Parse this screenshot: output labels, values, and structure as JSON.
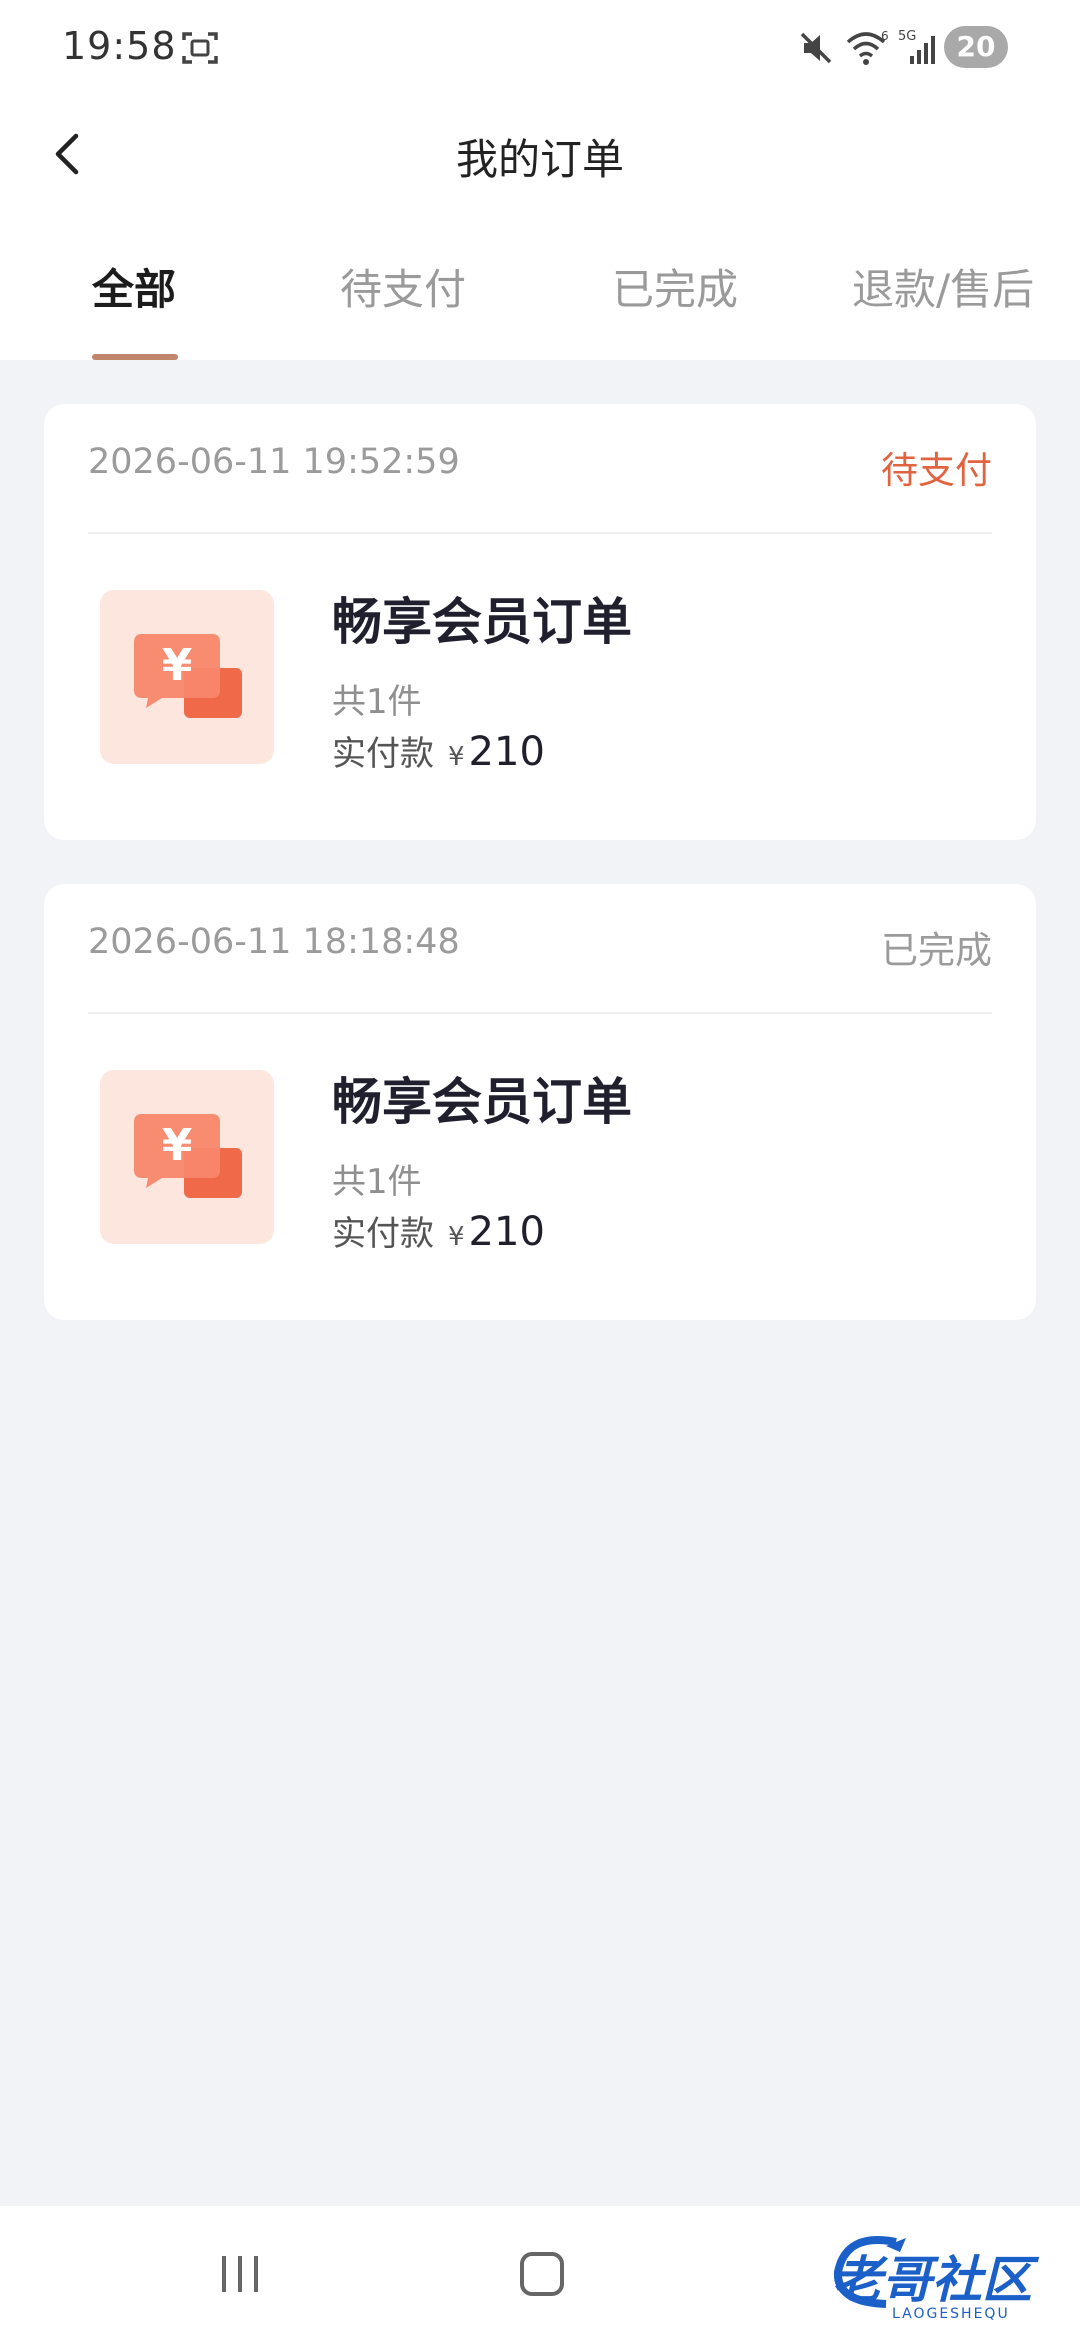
{
  "status_bar": {
    "time": "19:58",
    "battery": "20",
    "network": "5G"
  },
  "header": {
    "title": "我的订单"
  },
  "tabs": [
    {
      "label": "全部",
      "active": true
    },
    {
      "label": "待支付",
      "active": false
    },
    {
      "label": "已完成",
      "active": false
    },
    {
      "label": "退款/售后",
      "active": false
    }
  ],
  "orders": [
    {
      "time": "2026-06-11 19:52:59",
      "status": "待支付",
      "status_color": "#e0643f",
      "product_name": "畅享会员订单",
      "count": "共1件",
      "paid_label": "实付款",
      "currency": "¥",
      "amount": "210"
    },
    {
      "time": "2026-06-11 18:18:48",
      "status": "已完成",
      "status_color": "#9b9b9b",
      "product_name": "畅享会员订单",
      "count": "共1件",
      "paid_label": "实付款",
      "currency": "¥",
      "amount": "210"
    }
  ],
  "watermark": {
    "text": "老哥社区",
    "sub": "LAOGESHEQU"
  },
  "colors": {
    "accent": "#c0856b",
    "pending": "#e0643f",
    "background": "#f2f3f7",
    "thumb_bg": "#fde6de",
    "icon_primary": "#f06a4a"
  }
}
